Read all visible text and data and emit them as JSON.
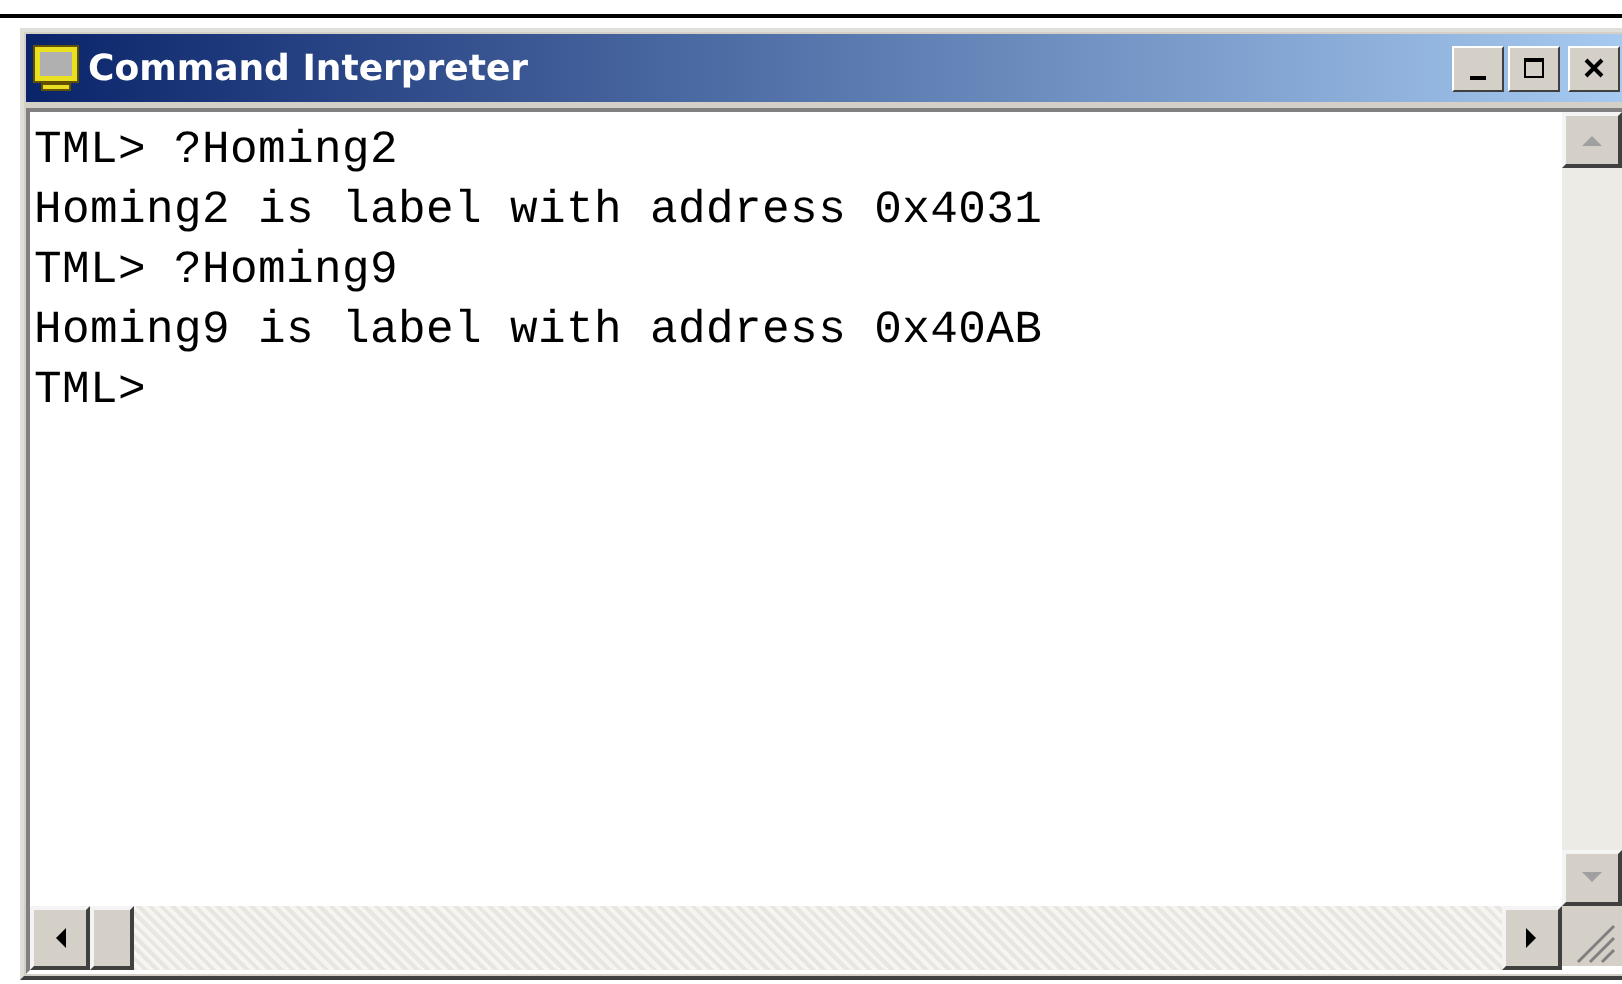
{
  "window": {
    "title": "Command Interpreter"
  },
  "console": {
    "lines": [
      {
        "text": "TML> ?Homing2"
      },
      {
        "text": "Homing2 is label with address 0x4031"
      },
      {
        "text": "TML> ?Homing9"
      },
      {
        "text": "Homing9 is label with address 0x40AB"
      },
      {
        "text": "TML>"
      }
    ]
  }
}
